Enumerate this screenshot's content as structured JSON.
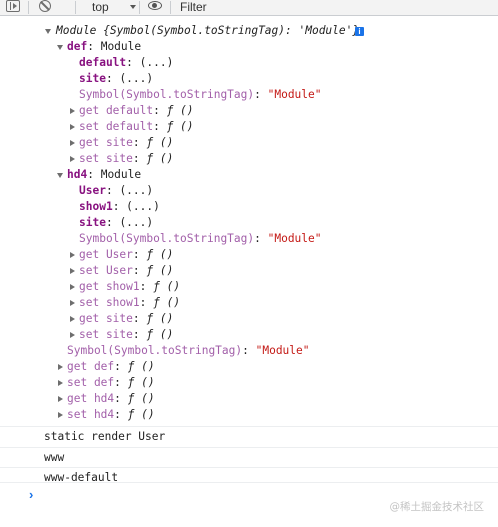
{
  "toolbar": {
    "context_label": "top",
    "filter_placeholder": "Filter"
  },
  "module": {
    "header_prefix": "Module ",
    "header_detail": "{Symbol(Symbol.toStringTag): 'Module'}",
    "info_badge": "i",
    "def": {
      "key": "def",
      "value": "Module",
      "props": [
        {
          "key": "default",
          "value": "(...)"
        },
        {
          "key": "site",
          "value": "(...)"
        }
      ],
      "tag_key": "Symbol(Symbol.toStringTag)",
      "tag_value": "\"Module\"",
      "accessors": [
        {
          "label": "get default",
          "fn": "ƒ ()"
        },
        {
          "label": "set default",
          "fn": "ƒ ()"
        },
        {
          "label": "get site",
          "fn": "ƒ ()"
        },
        {
          "label": "set site",
          "fn": "ƒ ()"
        }
      ]
    },
    "hd4": {
      "key": "hd4",
      "value": "Module",
      "props": [
        {
          "key": "User",
          "value": "(...)"
        },
        {
          "key": "show1",
          "value": "(...)"
        },
        {
          "key": "site",
          "value": "(...)"
        }
      ],
      "tag_key": "Symbol(Symbol.toStringTag)",
      "tag_value": "\"Module\"",
      "accessors": [
        {
          "label": "get User",
          "fn": "ƒ ()"
        },
        {
          "label": "set User",
          "fn": "ƒ ()"
        },
        {
          "label": "get show1",
          "fn": "ƒ ()"
        },
        {
          "label": "set show1",
          "fn": "ƒ ()"
        },
        {
          "label": "get site",
          "fn": "ƒ ()"
        },
        {
          "label": "set site",
          "fn": "ƒ ()"
        }
      ]
    },
    "tag_key": "Symbol(Symbol.toStringTag)",
    "tag_value": "\"Module\"",
    "accessors": [
      {
        "label": "get def",
        "fn": "ƒ ()"
      },
      {
        "label": "set def",
        "fn": "ƒ ()"
      },
      {
        "label": "get hd4",
        "fn": "ƒ ()"
      },
      {
        "label": "set hd4",
        "fn": "ƒ ()"
      }
    ]
  },
  "messages": [
    "static render User",
    "www",
    "www-default"
  ],
  "prompt_symbol": "›",
  "watermark": "@稀土掘金技术社区"
}
